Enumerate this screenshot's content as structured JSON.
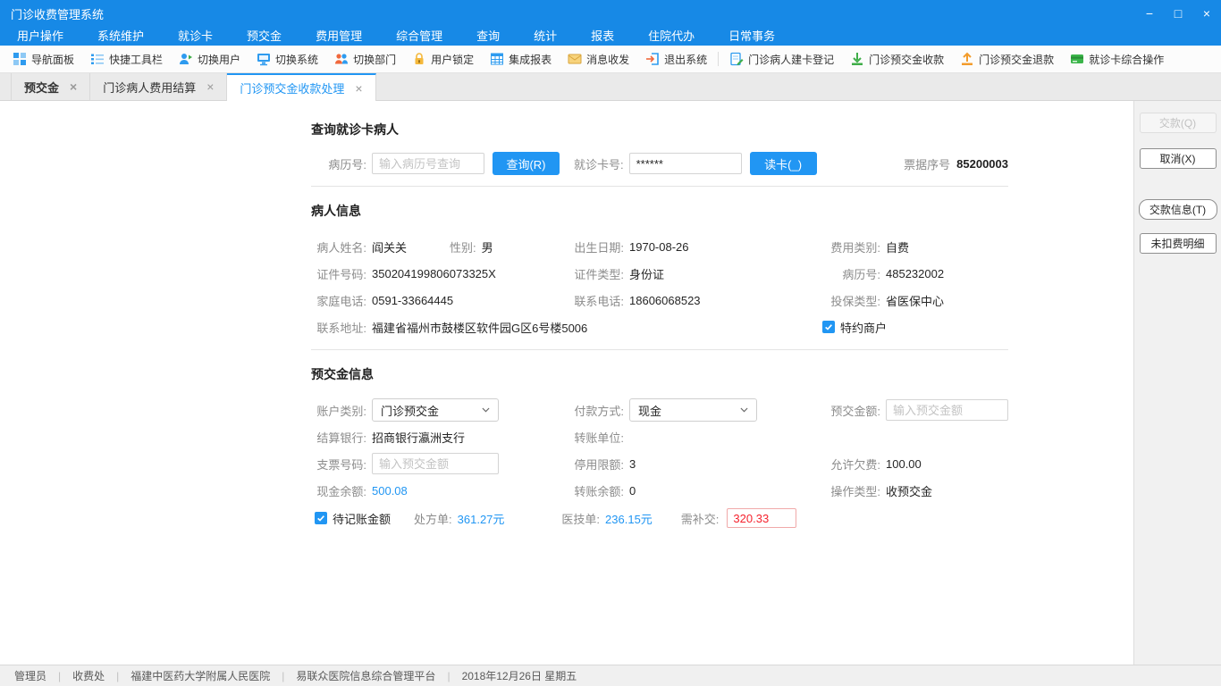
{
  "window": {
    "title": "门诊收费管理系统",
    "controls": {
      "minimize": "−",
      "maximize": "□",
      "close": "×"
    }
  },
  "glyphs": {
    "tab_close": "×"
  },
  "menu_items": [
    "用户操作",
    "系统维护",
    "就诊卡",
    "预交金",
    "费用管理",
    "综合管理",
    "查询",
    "统计",
    "报表",
    "住院代办",
    "日常事务"
  ],
  "toolbar_items": [
    {
      "icon": "nav-panel",
      "label": "导航面板"
    },
    {
      "icon": "quick-toolbar",
      "label": "快捷工具栏"
    },
    {
      "icon": "switch-user",
      "label": "切换用户"
    },
    {
      "icon": "switch-system",
      "label": "切换系统"
    },
    {
      "icon": "switch-department",
      "label": "切换部门"
    },
    {
      "icon": "user-lock",
      "label": "用户锁定"
    },
    {
      "icon": "integrated-reports",
      "label": "集成报表"
    },
    {
      "icon": "messages",
      "label": "消息收发"
    },
    {
      "icon": "exit-system",
      "label": "退出系统"
    },
    {
      "icon": "patient-card-register",
      "label": "门诊病人建卡登记"
    },
    {
      "icon": "prepay-collect",
      "label": "门诊预交金收款"
    },
    {
      "icon": "prepay-refund",
      "label": "门诊预交金退款"
    },
    {
      "icon": "card-operations",
      "label": "就诊卡综合操作"
    }
  ],
  "tabs": [
    {
      "label": "预交金",
      "active": false
    },
    {
      "label": "门诊病人费用结算",
      "active": false
    },
    {
      "label": "门诊预交金收款处理",
      "active": true
    }
  ],
  "query": {
    "section_title": "查询就诊卡病人",
    "mrn_label": "病历号:",
    "mrn_placeholder": "输入病历号查询",
    "query_button": "查询(R)",
    "card_label": "就诊卡号:",
    "card_value": "******",
    "read_card_button": "读卡(_)",
    "receipt_label": "票据序号",
    "receipt_number": "85200003"
  },
  "patient": {
    "section_title": "病人信息",
    "name_label": "病人姓名:",
    "name": "阎关关",
    "gender_label": "性别:",
    "gender": "男",
    "birth_label": "出生日期:",
    "birth": "1970-08-26",
    "fee_type_label": "费用类别:",
    "fee_type": "自费",
    "id_number_label": "证件号码:",
    "id_number": "350204199806073325X",
    "id_type_label": "证件类型:",
    "id_type": "身份证",
    "mrn_label": "病历号:",
    "mrn": "485232002",
    "home_phone_label": "家庭电话:",
    "home_phone": "0591-33664445",
    "phone_label": "联系电话:",
    "phone": "18606068523",
    "insurance_label": "投保类型:",
    "insurance": "省医保中心",
    "address_label": "联系地址:",
    "address": "福建省福州市鼓楼区软件园G区6号楼5006",
    "special_merchant_label": "特约商户"
  },
  "prepay": {
    "section_title": "预交金信息",
    "account_type_label": "账户类别:",
    "account_type_value": "门诊预交金",
    "pay_method_label": "付款方式:",
    "pay_method_value": "现金",
    "amount_label": "预交金额:",
    "amount_placeholder": "输入预交金额",
    "bank_label": "结算银行:",
    "bank": "招商银行瀛洲支行",
    "transfer_unit_label": "转账单位:",
    "transfer_unit": "",
    "check_number_label": "支票号码:",
    "check_number_placeholder": "输入预交金额",
    "stop_limit_label": "停用限额:",
    "stop_limit": "3",
    "allow_arrears_label": "允许欠费:",
    "allow_arrears": "100.00",
    "cash_balance_label": "现金余额:",
    "cash_balance": "500.08",
    "transfer_balance_label": "转账余额:",
    "transfer_balance": "0",
    "operation_type_label": "操作类型:",
    "operation_type": "收预交金",
    "pending_amount_label": "待记账金额",
    "prescription_label": "处方单:",
    "prescription_amount": "361.27元",
    "medtech_label": "医技单:",
    "medtech_amount": "236.15元",
    "due_label": "需补交:",
    "due_amount": "320.33"
  },
  "side_buttons": {
    "pay": "交款(Q)",
    "cancel": "取消(X)",
    "pay_info": "交款信息(T)",
    "undeducted_detail": "未扣费明细"
  },
  "statusbar": {
    "separator": "|",
    "items": [
      "管理员",
      "收费处",
      "福建中医药大学附属人民医院",
      "易联众医院信息综合管理平台",
      "2018年12月26日 星期五"
    ]
  },
  "colors": {
    "titlebar_blue": "#1789e6",
    "accent_blue": "#2196f3",
    "value_blue": "#2196f3",
    "danger_red": "#f5222d"
  }
}
